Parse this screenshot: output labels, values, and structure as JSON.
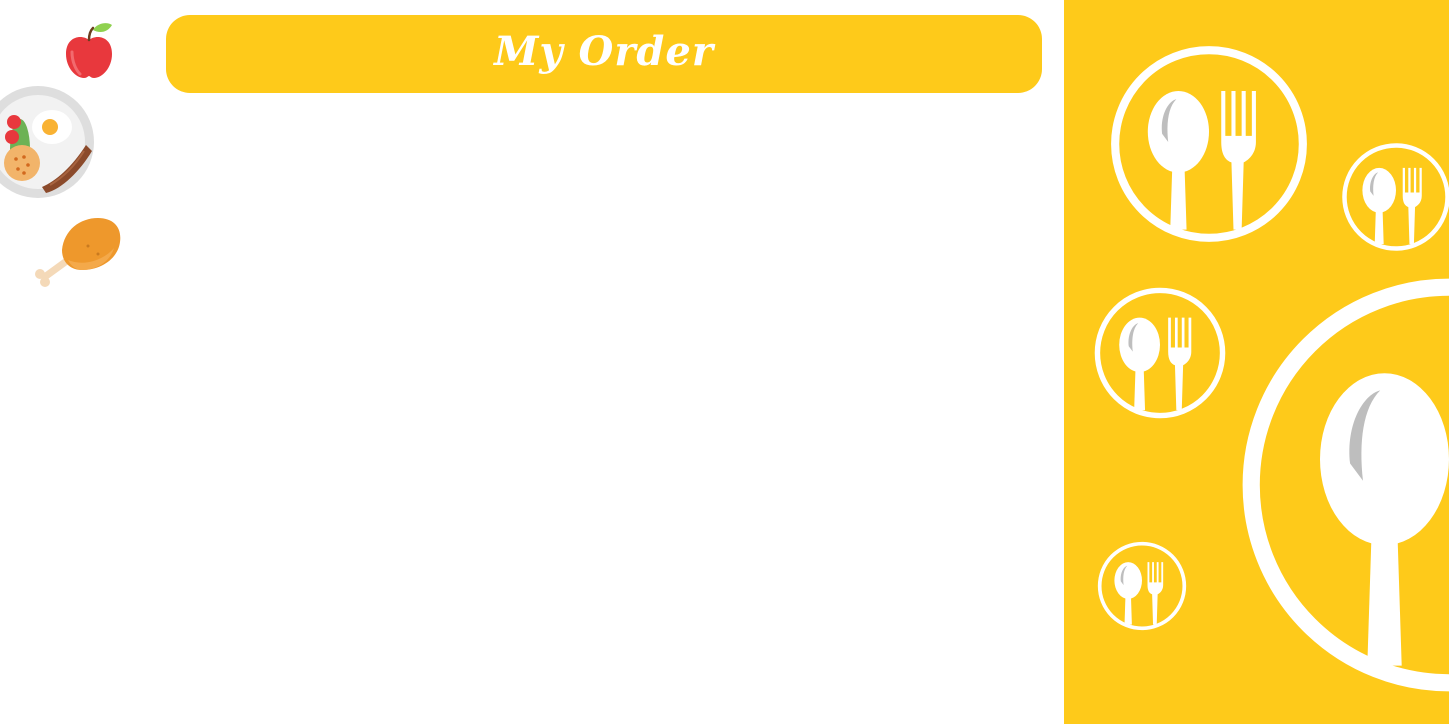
{
  "header": {
    "title": "My Order"
  },
  "colors": {
    "accent": "#FECA1A",
    "background": "#FFFFFF",
    "title_text": "#FFFFFF"
  },
  "sidebar": {
    "items": [
      {
        "icon": "apple-icon"
      },
      {
        "icon": "breakfast-plate-icon"
      },
      {
        "icon": "chicken-leg-icon"
      }
    ]
  },
  "decoration": {
    "icon": "spoon-fork-icon"
  }
}
